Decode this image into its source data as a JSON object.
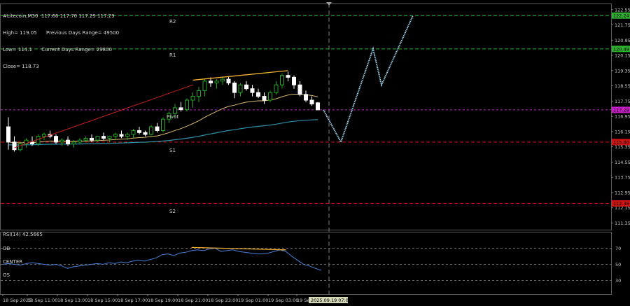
{
  "header": {
    "symbol_line": "#Litecoin,M30  117.66 117.70 117.29 117.29",
    "high": "High= 119.05",
    "prev_days_range": "Previous Days Range= 49500",
    "low": "Low= 114.1",
    "current_days_range": "Current Days Range= 29800",
    "close": "Close= 118.73"
  },
  "pivot_labels": {
    "r2": "R2",
    "r1": "R1",
    "pivot": "Pivot",
    "s1": "S1",
    "s2": "S2"
  },
  "price_axis": {
    "ticks": [
      "122.55",
      "121.75",
      "120.95",
      "120.15",
      "119.35",
      "118.55",
      "117.75",
      "116.95",
      "116.15",
      "115.35",
      "114.55",
      "113.75",
      "112.95",
      "112.15",
      "111.35"
    ],
    "level_tags": [
      {
        "text": "122.24",
        "color": "#2fae2f",
        "price": 122.24
      },
      {
        "text": "120.49",
        "color": "#2fae2f",
        "price": 120.49
      },
      {
        "text": "117.29",
        "color": "#c41fc4",
        "price": 117.29
      },
      {
        "text": "115.60",
        "color": "#d01414",
        "price": 115.6
      },
      {
        "text": "112.38",
        "color": "#d01414",
        "price": 112.38
      }
    ]
  },
  "rsi": {
    "label": "RSI(14) 42.5665",
    "ob": "OB",
    "center": "CENTER",
    "os": "OS",
    "ticks": [
      "70",
      "50",
      "30"
    ]
  },
  "time_axis": {
    "ticks": [
      "18 Sep 2025",
      "18 Sep 11:00",
      "18 Sep 13:00",
      "18 Sep 15:00",
      "18 Sep 17:00",
      "18 Sep 19:00",
      "18 Sep 21:00",
      "18 Sep 23:00",
      "19 Sep 01:00",
      "19 Sep 03:00",
      "19 Se"
    ],
    "cursor_time": "2025.09.19 07:00"
  },
  "colors": {
    "bull": "#22a822",
    "bear": "#ffffff",
    "resistance": "#2fae2f",
    "support": "#d01414",
    "current": "#c41fc4",
    "projection": "#9fd4ee",
    "trend": "#c22020",
    "divergence": "#f0b030",
    "ma_slow": "#2f8fa8",
    "ma_fast": "#d8b870",
    "rsi": "#4a7fd8"
  },
  "chart_data": [
    {
      "type": "candlestick",
      "title": "#Litecoin,M30",
      "ylim": [
        111.0,
        122.8
      ],
      "pivots": {
        "r2": 122.24,
        "r1": 120.49,
        "pivot": 117.2,
        "s1": 115.6,
        "s2": 112.38
      },
      "current_price": 117.29,
      "candles": [
        [
          116.4,
          116.9,
          115.2,
          115.6
        ],
        [
          115.6,
          115.9,
          115.1,
          115.2
        ],
        [
          115.2,
          115.6,
          115.1,
          115.5
        ],
        [
          115.5,
          115.8,
          115.3,
          115.7
        ],
        [
          115.6,
          115.9,
          115.4,
          115.5
        ],
        [
          115.5,
          116.0,
          115.4,
          115.9
        ],
        [
          115.9,
          116.1,
          115.7,
          116.0
        ],
        [
          116.0,
          116.2,
          115.8,
          115.9
        ],
        [
          115.9,
          116.0,
          115.5,
          115.6
        ],
        [
          115.6,
          115.8,
          115.4,
          115.7
        ],
        [
          115.7,
          115.9,
          115.4,
          115.5
        ],
        [
          115.5,
          115.7,
          115.3,
          115.6
        ],
        [
          115.6,
          115.8,
          115.5,
          115.7
        ],
        [
          115.7,
          115.9,
          115.6,
          115.8
        ],
        [
          115.8,
          116.0,
          115.6,
          115.7
        ],
        [
          115.7,
          115.9,
          115.6,
          115.9
        ],
        [
          115.9,
          116.1,
          115.7,
          115.8
        ],
        [
          115.8,
          115.9,
          115.6,
          115.9
        ],
        [
          115.9,
          116.1,
          115.7,
          116.0
        ],
        [
          116.0,
          116.2,
          115.8,
          115.9
        ],
        [
          115.9,
          116.1,
          115.7,
          116.0
        ],
        [
          116.0,
          116.3,
          115.8,
          116.2
        ],
        [
          116.2,
          116.4,
          116.0,
          116.1
        ],
        [
          116.1,
          116.2,
          115.9,
          116.0
        ],
        [
          116.0,
          116.5,
          115.9,
          116.4
        ],
        [
          116.4,
          116.6,
          116.1,
          116.2
        ],
        [
          116.2,
          116.9,
          116.1,
          116.8
        ],
        [
          116.8,
          117.2,
          116.6,
          117.1
        ],
        [
          117.1,
          117.6,
          116.9,
          117.4
        ],
        [
          117.4,
          117.7,
          117.2,
          117.3
        ],
        [
          117.3,
          117.9,
          117.2,
          117.8
        ],
        [
          117.8,
          118.2,
          117.4,
          118.0
        ],
        [
          118.0,
          118.5,
          117.7,
          118.3
        ],
        [
          118.3,
          118.9,
          118.0,
          118.8
        ],
        [
          118.8,
          119.0,
          118.5,
          118.7
        ],
        [
          118.7,
          118.9,
          118.4,
          118.8
        ],
        [
          118.8,
          119.0,
          118.6,
          118.9
        ],
        [
          118.9,
          119.05,
          118.6,
          118.7
        ],
        [
          118.7,
          118.8,
          117.9,
          118.2
        ],
        [
          118.2,
          118.7,
          118.0,
          118.6
        ],
        [
          118.6,
          118.8,
          118.3,
          118.4
        ],
        [
          118.4,
          118.6,
          118.0,
          118.2
        ],
        [
          118.2,
          118.4,
          117.9,
          118.0
        ],
        [
          118.0,
          118.2,
          117.6,
          117.8
        ],
        [
          117.8,
          118.3,
          117.7,
          118.2
        ],
        [
          118.2,
          118.8,
          118.1,
          118.6
        ],
        [
          118.6,
          119.2,
          118.4,
          119.1
        ],
        [
          119.1,
          119.3,
          118.8,
          119.0
        ],
        [
          119.0,
          119.1,
          118.4,
          118.6
        ],
        [
          118.6,
          118.8,
          118.0,
          118.1
        ],
        [
          118.1,
          118.3,
          117.7,
          117.8
        ],
        [
          117.8,
          118.0,
          117.5,
          117.6
        ],
        [
          117.66,
          117.7,
          117.29,
          117.29
        ]
      ],
      "projection": [
        [
          117.29,
          0
        ],
        [
          115.6,
          1
        ],
        [
          120.49,
          2
        ],
        [
          118.6,
          3
        ],
        [
          122.24,
          4
        ]
      ]
    },
    {
      "type": "line",
      "title": "RSI(14) 42.5665",
      "ylim": [
        20,
        80
      ],
      "levels": {
        "ob": 70,
        "center": 50,
        "os": 30
      },
      "values": [
        50,
        51,
        50,
        49,
        51,
        52,
        51,
        50,
        49,
        50,
        48,
        45,
        47,
        48,
        49,
        50,
        51,
        50,
        52,
        51,
        53,
        52,
        54,
        55,
        54,
        56,
        58,
        62,
        63,
        61,
        64,
        65,
        67,
        68,
        67,
        69,
        70,
        66,
        67,
        68,
        66,
        65,
        64,
        63,
        63,
        64,
        66,
        68,
        66,
        60,
        55,
        50,
        48,
        45,
        42.57
      ]
    }
  ]
}
